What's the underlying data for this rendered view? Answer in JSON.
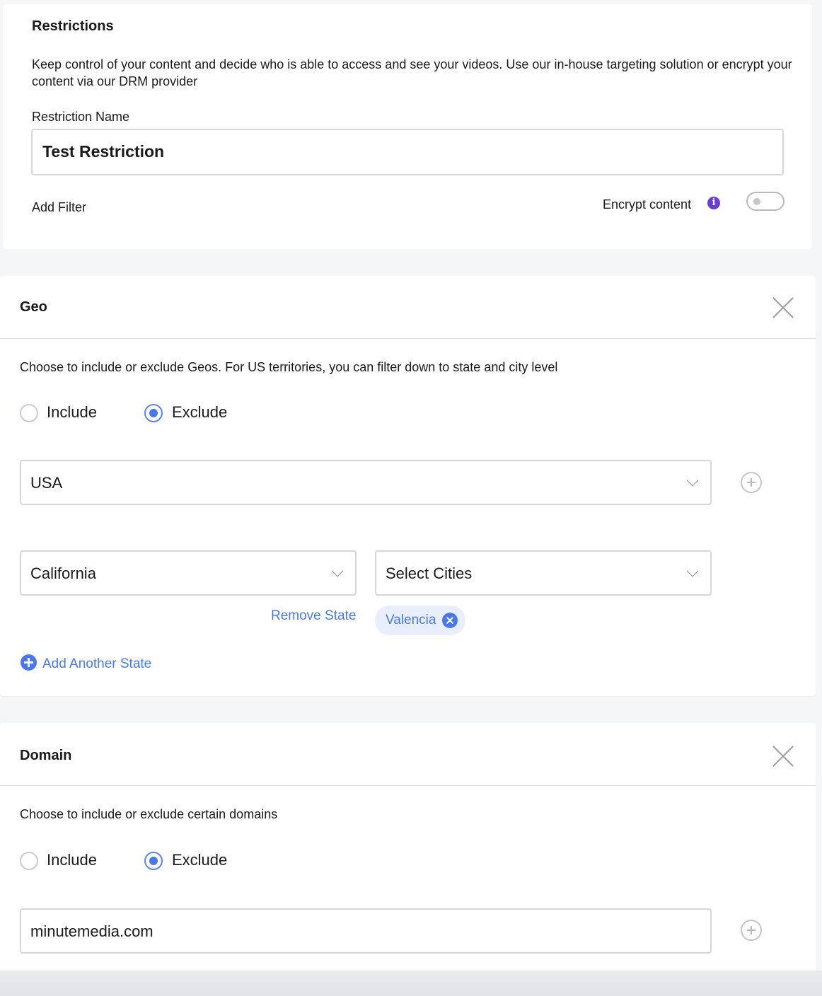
{
  "restrictions": {
    "title": "Restrictions",
    "description": "Keep control of your content and decide who is able to access and see your videos. Use our in-house targeting solution or encrypt your content via our DRM provider",
    "name_label": "Restriction Name",
    "name_value": "Test Restriction",
    "add_filter_label": "Add Filter",
    "encrypt_label": "Encrypt content",
    "encrypt_enabled": false
  },
  "geo": {
    "title": "Geo",
    "description": "Choose to include or exclude Geos. For US territories, you can filter down to state and city level",
    "include_label": "Include",
    "exclude_label": "Exclude",
    "selected_mode": "Exclude",
    "country_value": "USA",
    "state_value": "California",
    "cities_placeholder": "Select Cities",
    "remove_state_label": "Remove State",
    "city_chips": [
      "Valencia"
    ],
    "add_state_label": "Add Another State"
  },
  "domain": {
    "title": "Domain",
    "description": "Choose to include or exclude certain domains",
    "include_label": "Include",
    "exclude_label": "Exclude",
    "selected_mode": "Exclude",
    "domain_value": "minutemedia.com"
  },
  "colors": {
    "accent": "#4a78ec",
    "info_icon": "#6a3fd6",
    "border": "#d6d7dd"
  }
}
